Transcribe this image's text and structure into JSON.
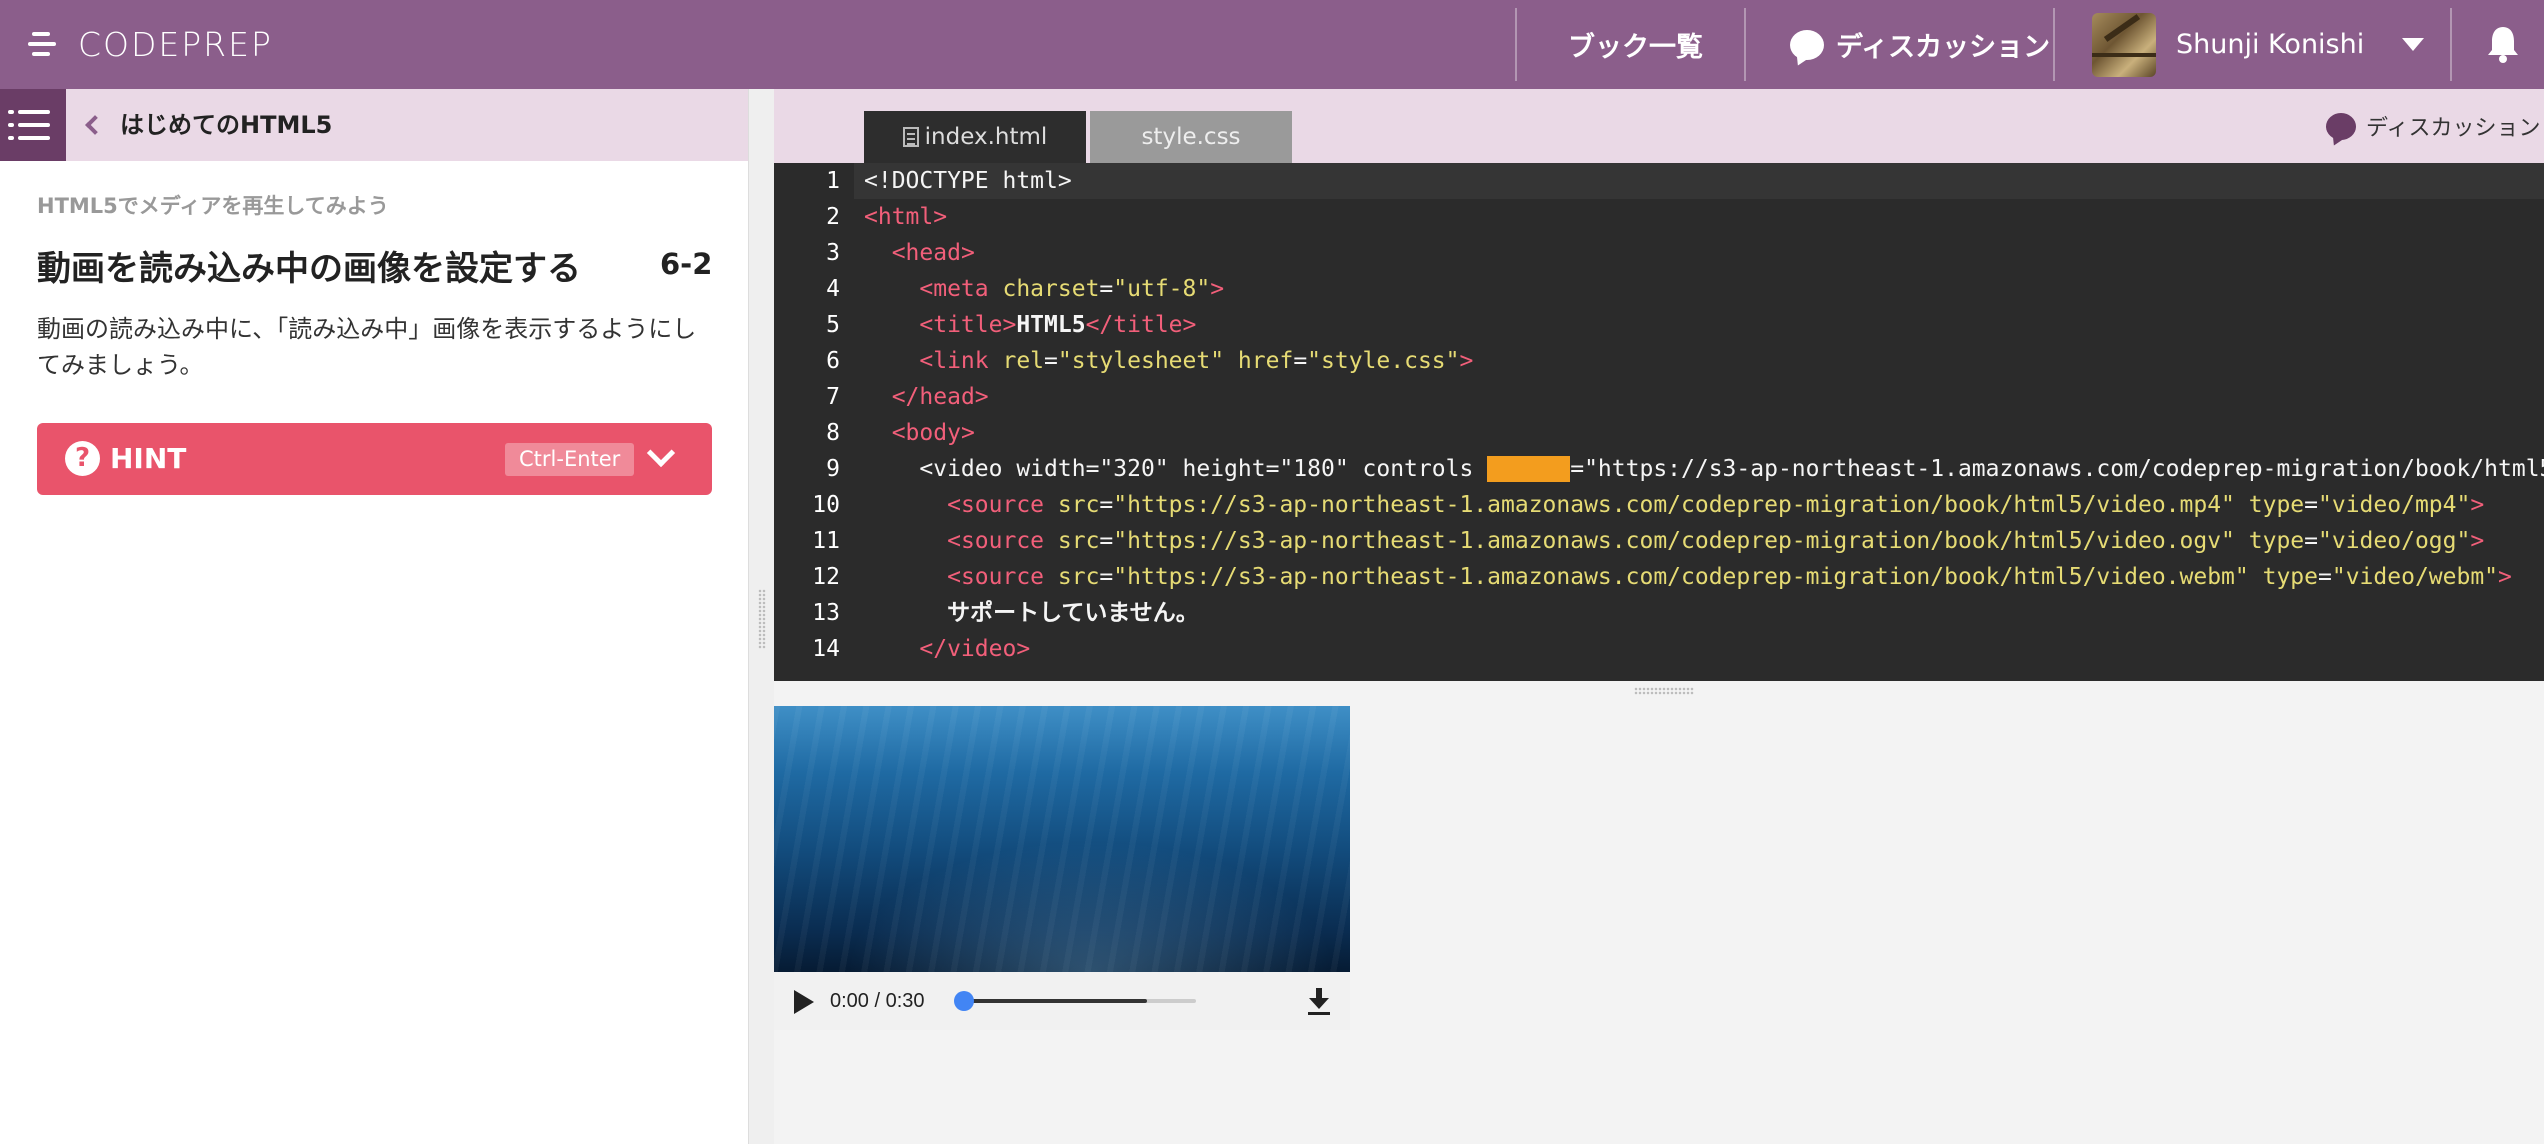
{
  "header": {
    "logo": "CODEPREP",
    "nav_books": "ブック一覧",
    "nav_discussion": "ディスカッション",
    "user_name": "Shunji Konishi",
    "accent_color": "#8b5e8b"
  },
  "sidebar": {
    "book_title": "はじめてのHTML5",
    "section": "HTML5でメディアを再生してみよう",
    "lesson_title": "動画を読み込み中の画像を設定する",
    "lesson_number": "6-2",
    "description": "動画の読み込み中に、「読み込み中」画像を表示するようにしてみましょう。",
    "hint": {
      "label": "HINT",
      "shortcut": "Ctrl-Enter",
      "color": "#e9546b"
    }
  },
  "editor": {
    "tabs": [
      {
        "label": "index.html",
        "active": true
      },
      {
        "label": "style.css",
        "active": false
      }
    ],
    "discussion_label": "ディスカッション",
    "line_numbers": [
      "1",
      "2",
      "3",
      "4",
      "5",
      "6",
      "7",
      "8",
      "9",
      "10",
      "11",
      "12",
      "13",
      "14"
    ],
    "lines": {
      "l1": "<!DOCTYPE html>",
      "l2": "<html>",
      "l3_indent": "  ",
      "l3": "<head>",
      "l4_indent": "    ",
      "l4_tag": "<meta ",
      "l4_attr": "charset",
      "l4_eq": "=",
      "l4_val": "\"utf-8\"",
      "l4_close": ">",
      "l5_indent": "    ",
      "l5_open": "<title>",
      "l5_text": "HTML5",
      "l5_close": "</title>",
      "l6_indent": "    ",
      "l6_tag": "<link ",
      "l6_attr1": "rel",
      "l6_val1": "\"stylesheet\"",
      "l6_attr2": " href",
      "l6_val2": "\"style.css\"",
      "l6_close": ">",
      "l7_indent": "  ",
      "l7": "</head>",
      "l8_indent": "  ",
      "l8": "<body>",
      "l9_indent": "    ",
      "l9_tag": "<video ",
      "l9_attrs": "width=\"320\" height=\"180\" controls ",
      "l9_blank": "      ",
      "l9_rest": "=\"https://s3-ap-northeast-1.amazonaws.com/codeprep-migration/book/html5/",
      "l10_indent": "      ",
      "l10_tag": "<source ",
      "l10_attr": "src",
      "l10_val": "\"https://s3-ap-northeast-1.amazonaws.com/codeprep-migration/book/html5/video.mp4\"",
      "l10_attr2": " type",
      "l10_val2": "\"video/mp4\"",
      "l10_close": ">",
      "l11_indent": "      ",
      "l11_tag": "<source ",
      "l11_attr": "src",
      "l11_val": "\"https://s3-ap-northeast-1.amazonaws.com/codeprep-migration/book/html5/video.ogv\"",
      "l11_attr2": " type",
      "l11_val2": "\"video/ogg\"",
      "l11_close": ">",
      "l12_indent": "      ",
      "l12_tag": "<source ",
      "l12_attr": "src",
      "l12_val": "\"https://s3-ap-northeast-1.amazonaws.com/codeprep-migration/book/html5/video.webm\"",
      "l12_attr2": " type",
      "l12_val2": "\"video/webm\"",
      "l12_close": ">",
      "l13_indent": "      ",
      "l13": "サポートしていません。",
      "l14_indent": "    ",
      "l14": "</video>"
    }
  },
  "preview": {
    "time": "0:00 / 0:30",
    "progress_buffered_fraction": 0.79,
    "progress_played_fraction": 0.0
  }
}
